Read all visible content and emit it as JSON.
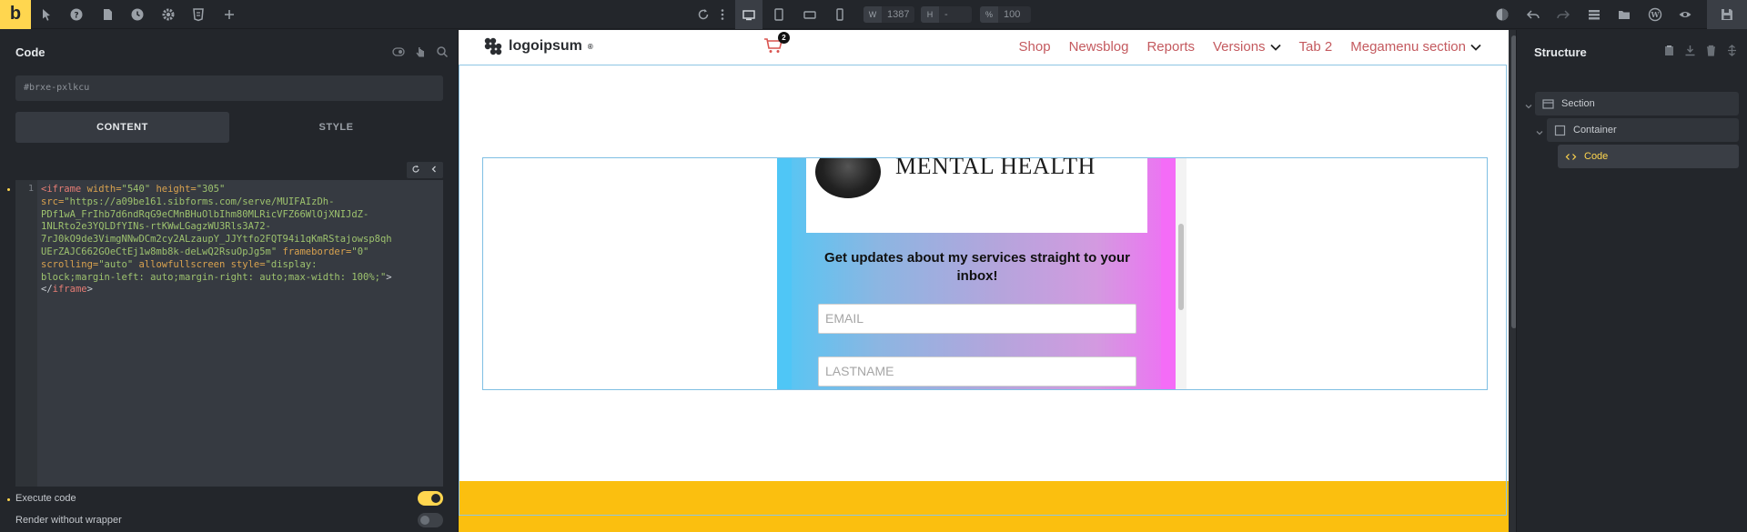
{
  "toolbar": {
    "logo_letter": "b",
    "width_label": "W",
    "width_value": "1387",
    "height_label": "H",
    "height_value": "-",
    "zoom_label": "%",
    "zoom_value": "100",
    "accent_color": "#ffd64f"
  },
  "left_panel": {
    "title": "Code",
    "element_id": "#brxe-pxlkcu",
    "tabs": [
      {
        "label": "CONTENT",
        "active": true
      },
      {
        "label": "STYLE",
        "active": false
      }
    ],
    "line_number": "1",
    "code": {
      "l1_tag_open": "<iframe",
      "l1_attr1": " width=",
      "l1_val1": "\"540\"",
      "l1_attr2": " height=",
      "l1_val2": "\"305\"",
      "l2_attr": "src=",
      "l2_val": "\"https://a09be161.sibforms.com/serve/MUIFAIzDh-",
      "l3": "PDf1wA_FrIhb7d6ndRqG9eCMnBHuOlbIhm80MLRicVFZ66WlOjXNIJdZ-",
      "l4": "1NLRto2e3YQLDfYINs-rtKWwLGagzWU3Rls3A72-",
      "l5": "7rJ0kO9de3VimgNNwDCm2cy2ALzaupY_JJYtfo2FQT94i1qKmRStajowsp8qh",
      "l6_val": "UErZAJC662GOeCtEj1w8mb8k-deLwQ2RsuOpJg5m\"",
      "l6_attr": " frameborder=",
      "l6_val2": "\"0\"",
      "l7_attr1": "scrolling=",
      "l7_val1": "\"auto\"",
      "l7_attr2": " allowfullscreen style=",
      "l7_val2": "\"display:",
      "l8_val": "block;margin-left: auto;margin-right: auto;max-width: 100%;\"",
      "l8_close": ">",
      "l9_close": "</",
      "l9_tag": "iframe",
      "l9_end": ">"
    },
    "options": {
      "execute_code_label": "Execute code",
      "execute_code_on": true,
      "render_without_wrapper_label": "Render without wrapper",
      "render_without_wrapper_on": false
    }
  },
  "canvas": {
    "site_logo_text": "logoipsum",
    "logo_sup": "®",
    "cart_count": "2",
    "nav": [
      {
        "label": "Shop",
        "dropdown": false
      },
      {
        "label": "Newsblog",
        "dropdown": false
      },
      {
        "label": "Reports",
        "dropdown": false
      },
      {
        "label": "Versions",
        "dropdown": true
      },
      {
        "label": "Tab 2",
        "dropdown": false
      },
      {
        "label": "Megamenu section",
        "dropdown": true
      }
    ],
    "nav_color": "#c45a5f",
    "iframe": {
      "brand_text": "MENTAL HEALTH",
      "heading": "Get updates about my services straight to your inbox!",
      "email_placeholder": "EMAIL",
      "lastname_placeholder": "LASTNAME"
    },
    "footer_color": "#fbbf0f"
  },
  "right_panel": {
    "title": "Structure",
    "tree": [
      {
        "label": "Section",
        "icon": "section-icon",
        "depth": 0
      },
      {
        "label": "Container",
        "icon": "container-icon",
        "depth": 1
      },
      {
        "label": "Code",
        "icon": "code-icon",
        "depth": 2,
        "active": true
      }
    ]
  }
}
